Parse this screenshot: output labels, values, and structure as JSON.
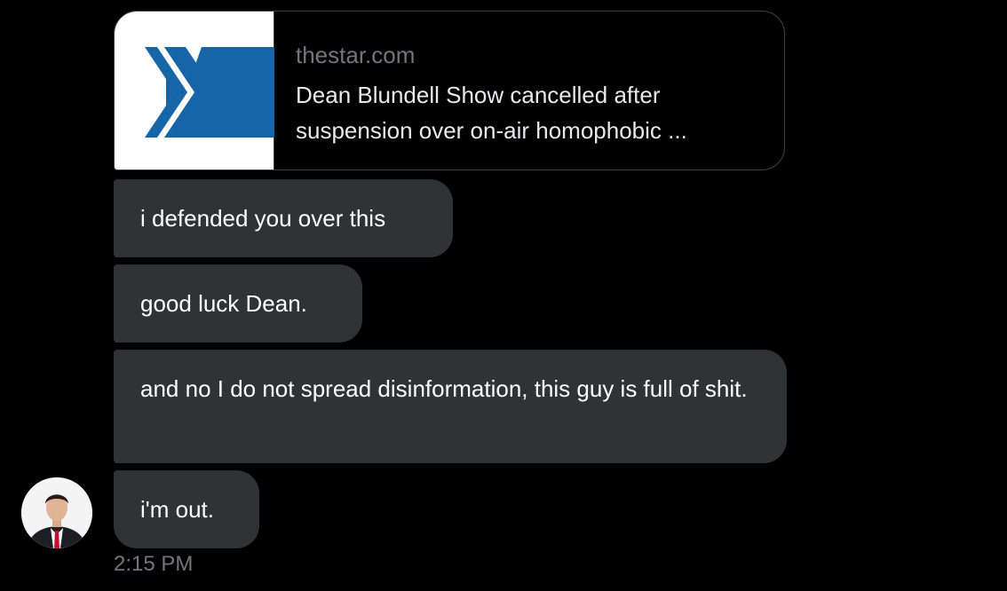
{
  "link_card": {
    "domain": "thestar.com",
    "title": "Dean Blundell Show cancelled after suspension over on-air homophobic ...",
    "thumbnail_icon": "toronto-star-logo",
    "logo_color": "#1565a8"
  },
  "messages": [
    {
      "text": "i defended you over this"
    },
    {
      "text": "good luck Dean."
    },
    {
      "text": "and no I do not spread disinformation, this guy is full of shit."
    },
    {
      "text": "i'm out."
    }
  ],
  "timestamp": "2:15 PM",
  "colors": {
    "background": "#000000",
    "bubble": "#2f3336",
    "muted_text": "#71767b",
    "card_border": "#3e4144"
  }
}
